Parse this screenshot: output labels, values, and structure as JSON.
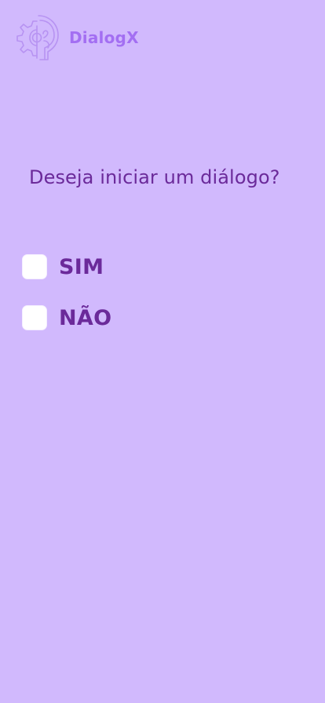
{
  "app": {
    "name": "DialogX",
    "logo_icon": "brain-gear-logo-icon",
    "brand_color": "#a36ff2"
  },
  "theme": {
    "background": "#d1b9fd",
    "text": "#6b2a9a",
    "checkbox": "#ffffff"
  },
  "question": {
    "text": "Deseja iniciar um diálogo?"
  },
  "options": [
    {
      "label": "SIM",
      "checked": false
    },
    {
      "label": "NÃO",
      "checked": false
    }
  ]
}
